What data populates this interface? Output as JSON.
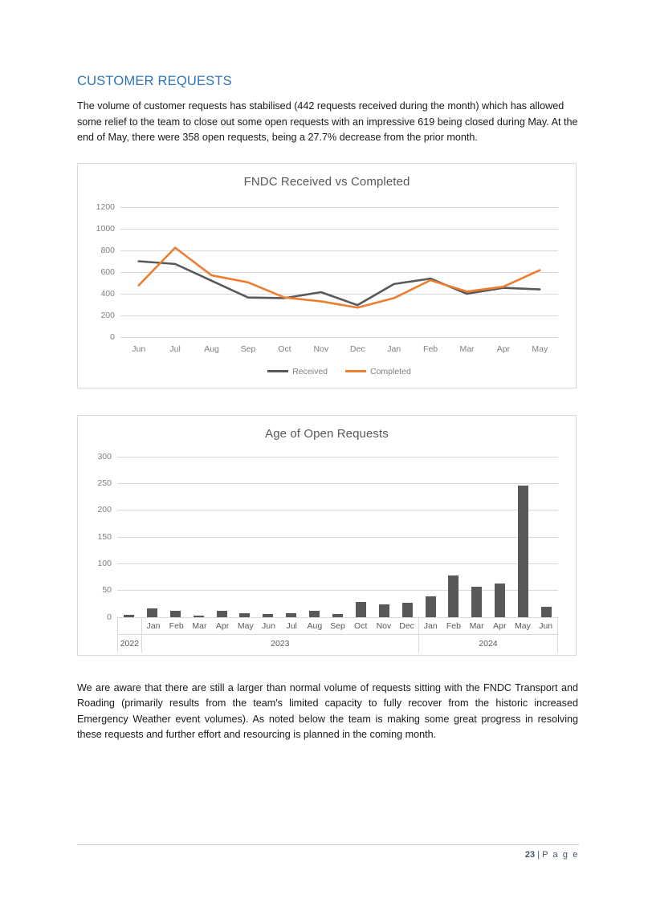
{
  "document": {
    "heading": "CUSTOMER REQUESTS",
    "paragraph_1": "The volume of customer requests has stabilised (442 requests received during the month) which has allowed some relief to the team to close out some open requests with an impressive 619 being closed during May.  At the end of May, there were 358 open requests, being a 27.7% decrease from the prior month.",
    "paragraph_2": "We are aware that there are still a larger than normal volume of requests sitting with the FNDC Transport and Roading (primarily results from the team's limited capacity to fully recover from the historic increased Emergency Weather event volumes). As noted below the team is making some great progress in resolving these requests and further effort and resourcing is planned in the coming month."
  },
  "footer": {
    "page_number": "23",
    "separator": "|",
    "page_word": "P a g e"
  },
  "colors": {
    "heading_blue": "#2E74B5",
    "received_gray": "#595959",
    "completed_orange": "#ED7D31",
    "bar_gray": "#595959",
    "gridline": "#D9D9D9",
    "axis_text": "#7F7F7F"
  },
  "chart_data": [
    {
      "type": "line",
      "title": "FNDC Received vs Completed",
      "xlabel": "",
      "ylabel": "",
      "ylim": [
        0,
        1200
      ],
      "yticks": [
        0,
        200,
        400,
        600,
        800,
        1000,
        1200
      ],
      "grid": true,
      "legend_position": "bottom",
      "categories": [
        "Jun",
        "Jul",
        "Aug",
        "Sep",
        "Oct",
        "Nov",
        "Dec",
        "Jan",
        "Feb",
        "Mar",
        "Apr",
        "May"
      ],
      "series": [
        {
          "name": "Received",
          "color": "#595959",
          "values": [
            700,
            675,
            520,
            365,
            360,
            415,
            295,
            490,
            540,
            400,
            455,
            440
          ]
        },
        {
          "name": "Completed",
          "color": "#ED7D31",
          "values": [
            478,
            825,
            570,
            505,
            365,
            330,
            272,
            360,
            525,
            420,
            465,
            618
          ]
        }
      ]
    },
    {
      "type": "bar",
      "title": "Age of Open Requests",
      "xlabel": "",
      "ylabel": "",
      "ylim": [
        0,
        300
      ],
      "yticks": [
        0,
        50,
        100,
        150,
        200,
        250,
        300
      ],
      "grid": true,
      "bar_color": "#595959",
      "groups": [
        {
          "year": "2022",
          "categories": [
            ""
          ],
          "values": [
            4
          ]
        },
        {
          "year": "2023",
          "categories": [
            "Jan",
            "Feb",
            "Mar",
            "Apr",
            "May",
            "Jun",
            "Jul",
            "Aug",
            "Sep",
            "Oct",
            "Nov",
            "Dec"
          ],
          "values": [
            16,
            12,
            2,
            11,
            7,
            6,
            7,
            12,
            6,
            28,
            23,
            27
          ]
        },
        {
          "year": "2024",
          "categories": [
            "Jan",
            "Feb",
            "Mar",
            "Apr",
            "May",
            "Jun"
          ],
          "values": [
            38,
            77,
            56,
            62,
            245,
            19
          ]
        }
      ]
    }
  ]
}
